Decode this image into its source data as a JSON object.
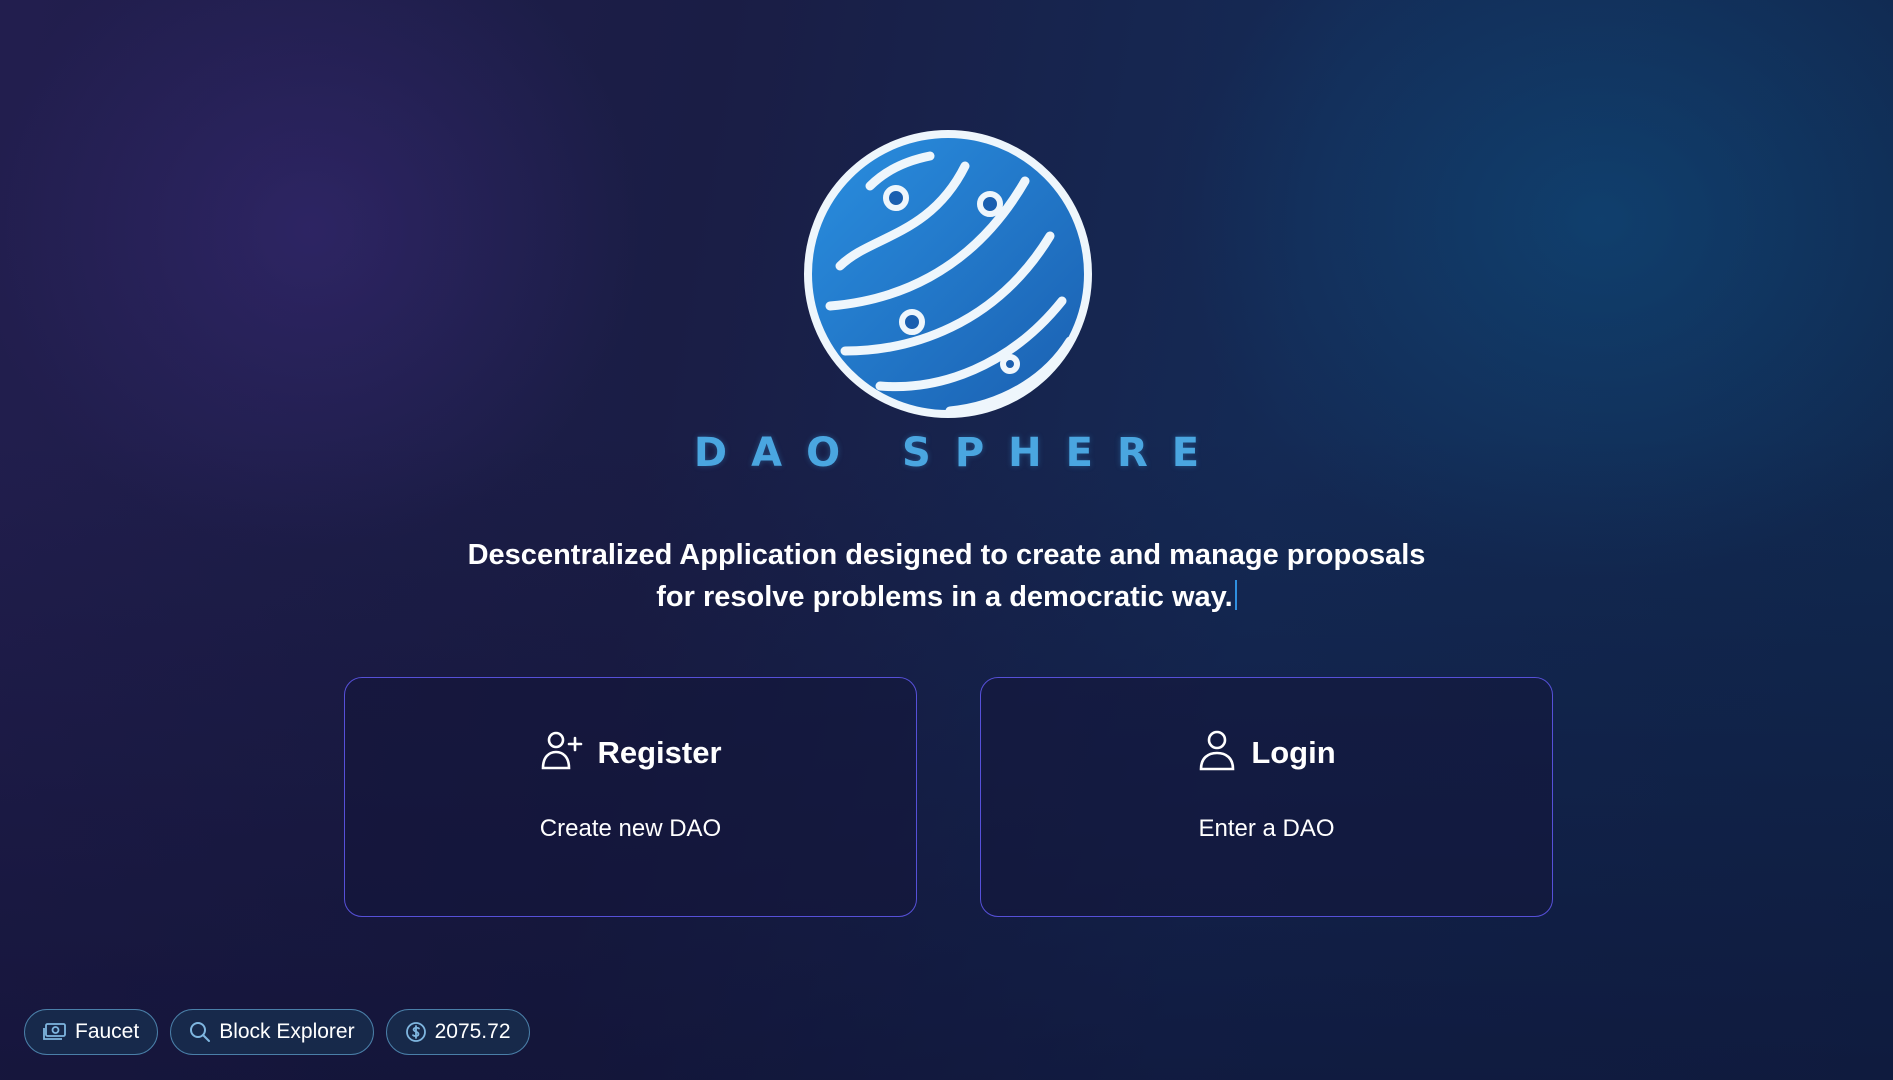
{
  "brand": {
    "logo_icon": "globe-circuit-logo",
    "name": "DAO SPHERE"
  },
  "tagline": {
    "line1": "Descentralized Application designed to create and manage proposals",
    "line2": "for resolve problems in a democratic way."
  },
  "cards": {
    "register": {
      "icon": "user-plus-icon",
      "title": "Register",
      "subtitle": "Create new DAO"
    },
    "login": {
      "icon": "user-icon",
      "title": "Login",
      "subtitle": "Enter a DAO"
    }
  },
  "footer": {
    "faucet": {
      "icon": "money-bill-icon",
      "label": "Faucet"
    },
    "explorer": {
      "icon": "search-icon",
      "label": "Block Explorer"
    },
    "balance": {
      "icon": "dollar-coin-icon",
      "label": "2075.72"
    }
  },
  "colors": {
    "card_border": "#5650d8",
    "brand_text": "#4aa6e0",
    "pill_border": "#4a7fa8"
  }
}
